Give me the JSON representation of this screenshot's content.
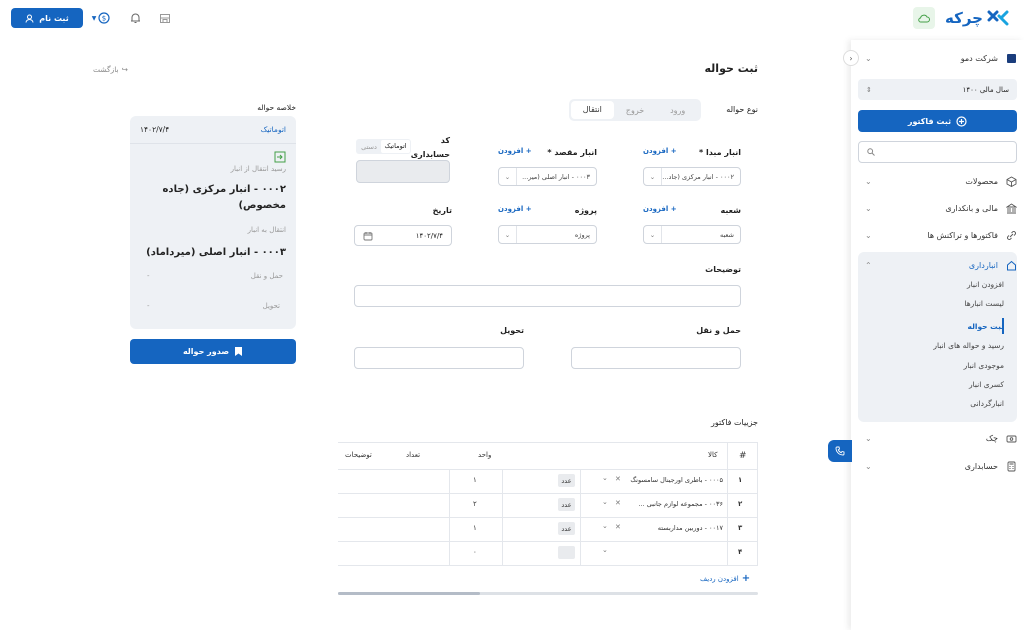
{
  "header": {
    "logo_text": "چرکه",
    "signup_label": "ثبت نام",
    "brand_color": "#1565c0"
  },
  "sidebar": {
    "company": "شرکت دمو",
    "fiscal_year": "سال مالی ۱۴۰۰",
    "invoice_button": "ثبت فاکتور",
    "search_placeholder": "",
    "items": [
      {
        "label": "محصولات",
        "icon": "cube-icon"
      },
      {
        "label": "مالی و بانکداری",
        "icon": "bank-icon"
      },
      {
        "label": "فاکتورها و تراکنش ها",
        "icon": "link-icon"
      },
      {
        "label": "انبارداری",
        "icon": "home-icon"
      },
      {
        "label": "چک",
        "icon": "cash-icon"
      },
      {
        "label": "حسابداری",
        "icon": "calculator-icon"
      }
    ],
    "warehouse_sub": [
      "افزودن انبار",
      "لیست انبارها",
      "ثبت حواله",
      "رسید و حواله های انبار",
      "موجودی انبار",
      "کسری انبار",
      "انبارگردانی"
    ],
    "active_sub": "ثبت حواله"
  },
  "page": {
    "title": "ثبت حواله",
    "back_label": "بازگشت"
  },
  "form": {
    "type_label": "نوع حواله",
    "type_options": [
      "ورود",
      "خروج",
      "انتقال"
    ],
    "type_selected": "انتقال",
    "add_link": "+ افزودن",
    "source_label": "انبار مبدا *",
    "source_value": "۰۰۰۲ - انبار مرکزی (جاد...",
    "dest_label": "انبار مقصد *",
    "dest_value": "۰۰۰۳ - انبار اصلی (میر...",
    "code_label_1": "کد",
    "code_label_2": "حسابداری",
    "code_auto": "اتوماتیک",
    "code_manual": "دستی",
    "branch_label": "شعبه",
    "branch_value": "شعبه",
    "project_label": "پروژه",
    "project_value": "پروژه",
    "date_label": "تاریخ",
    "date_value": "۱۴۰۲/۷/۴",
    "desc_label": "توضیحات",
    "transport_label": "حمل و نقل",
    "delivery_label": "تحویل"
  },
  "invoice_table": {
    "title": "جزییات فاکتور",
    "columns": [
      "#",
      "کالا",
      "واحد",
      "تعداد",
      "توضیحات"
    ],
    "rows": [
      {
        "num": "۱",
        "item": "۰۰۰۵ - باطری اورجینال سامسونگ",
        "unit": "عدد",
        "qty": "۱"
      },
      {
        "num": "۲",
        "item": "۰۰۳۶ - مجموعه لوازم جانبی ...",
        "unit": "عدد",
        "qty": "۲"
      },
      {
        "num": "۳",
        "item": "۰۰۱۷ - دوربین مداربسته",
        "unit": "عدد",
        "qty": "۱"
      },
      {
        "num": "۴",
        "item": "",
        "unit": "",
        "qty": "۰"
      }
    ],
    "add_row": "افزودن ردیف"
  },
  "summary": {
    "title": "خلاصه حواله",
    "mode": "اتوماتیک",
    "date": "۱۴۰۲/۷/۴",
    "from_caption": "رسید انتقال از انبار",
    "from_warehouse": "۰۰۰۲ - انبار مرکزی (جاده مخصوص)",
    "to_caption": "انتقال به انبار",
    "to_warehouse": "۰۰۰۳ - انبار اصلی (میرداماد)",
    "transport_label": "حمل و نقل",
    "transport_value": "-",
    "delivery_label": "تحویل",
    "delivery_value": "-",
    "issue_button": "صدور حواله"
  }
}
